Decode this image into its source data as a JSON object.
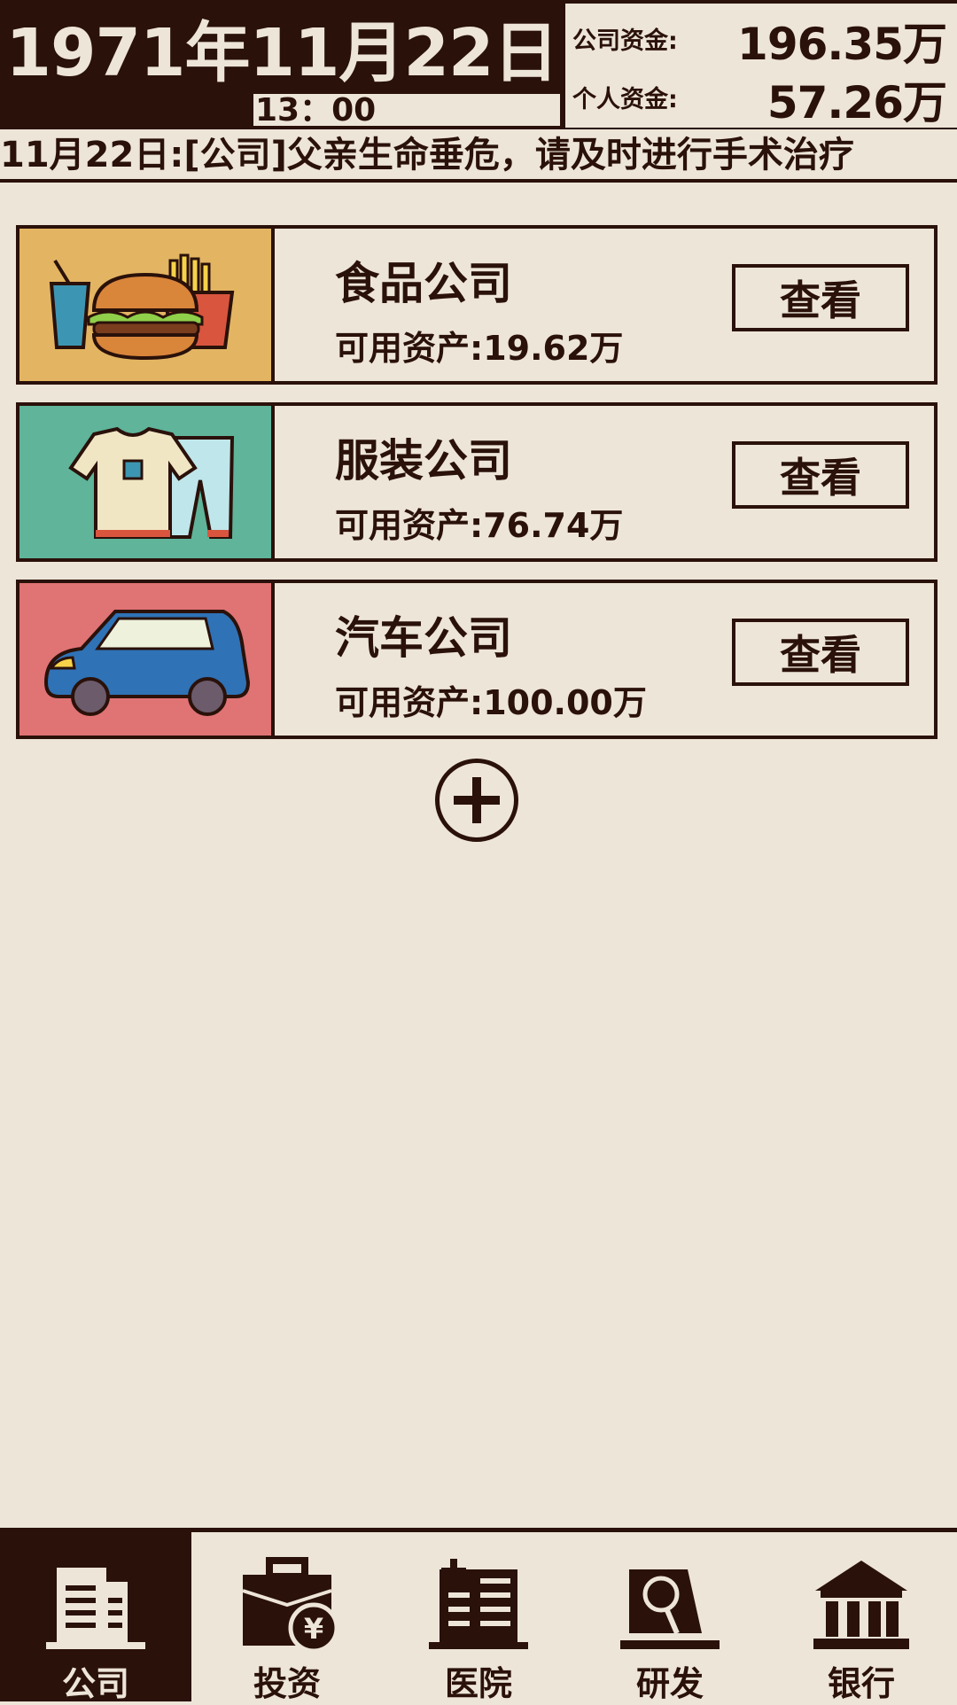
{
  "header": {
    "date": "1971年11月22日",
    "time": "13：00",
    "company_funds_label": "公司资金:",
    "company_funds_value": "196.35万",
    "personal_funds_label": "个人资金:",
    "personal_funds_value": "57.26万"
  },
  "news": {
    "text": "11月22日:[公司]父亲生命垂危，请及时进行手术治疗"
  },
  "companies": [
    {
      "name": "食品公司",
      "assets": "可用资产:19.62万",
      "button": "查看",
      "thumb_color": "#e3b562",
      "icon": "food-icon"
    },
    {
      "name": "服装公司",
      "assets": "可用资产:76.74万",
      "button": "查看",
      "thumb_color": "#5fb49a",
      "icon": "clothing-icon"
    },
    {
      "name": "汽车公司",
      "assets": "可用资产:100.00万",
      "button": "查看",
      "thumb_color": "#e07374",
      "icon": "car-icon"
    }
  ],
  "add_button": {
    "icon": "plus-icon"
  },
  "nav": [
    {
      "label": "公司",
      "icon": "building-icon",
      "active": true
    },
    {
      "label": "投资",
      "icon": "briefcase-yen-icon",
      "active": false
    },
    {
      "label": "医院",
      "icon": "hospital-icon",
      "active": false
    },
    {
      "label": "研发",
      "icon": "microscope-icon",
      "active": false
    },
    {
      "label": "银行",
      "icon": "bank-icon",
      "active": false
    }
  ],
  "colors": {
    "background": "#ede5d8",
    "dark": "#2a110a",
    "food_bg": "#e3b562",
    "clothing_bg": "#5fb49a",
    "car_bg": "#e07374"
  }
}
